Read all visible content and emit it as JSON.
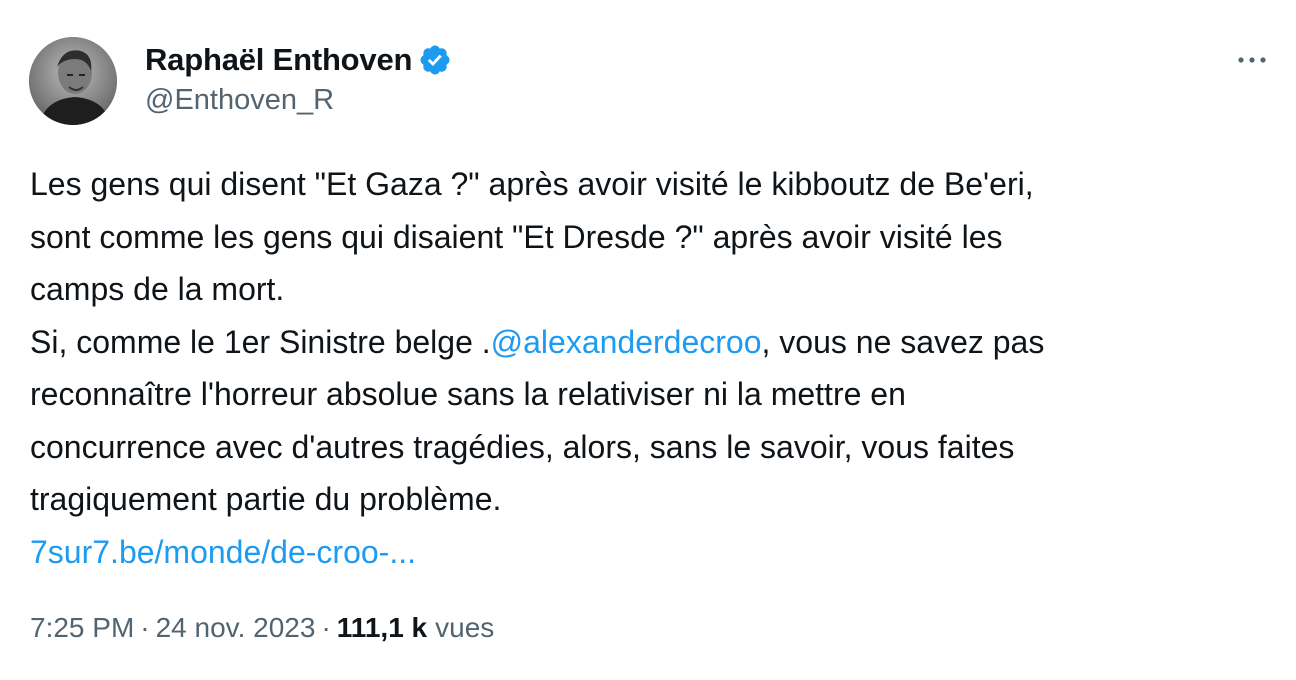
{
  "author": {
    "name": "Raphaël Enthoven",
    "handle": "@Enthoven_R",
    "verified_icon": "verified-badge-icon",
    "verified_color": "#1d9bf0",
    "avatar_icon": "profile-photo"
  },
  "menu": {
    "icon": "more-options-icon"
  },
  "tweet": {
    "line1": "Les gens qui disent \"Et Gaza ?\" après avoir visité le kibboutz de Be'eri,",
    "line2": "sont comme les gens qui disaient \"Et Dresde ?\" après avoir visité les",
    "line3": "camps de la mort.",
    "line4_before": "Si, comme le 1er Sinistre belge .",
    "mention": "@alexanderdecroo",
    "line4_after": ", vous ne savez pas",
    "line5": "reconnaître l'horreur absolue sans la relativiser ni la mettre en",
    "line6": "concurrence avec d'autres tragédies, alors, sans le savoir, vous faites",
    "line7": "tragiquement partie du problème.",
    "url": "7sur7.be/monde/de-croo-..."
  },
  "meta": {
    "time": "7:25 PM",
    "separator": "·",
    "date": "24 nov. 2023",
    "views_count": "111,1 k",
    "views_label": "vues"
  },
  "colors": {
    "text": "#0f1419",
    "secondary": "#536471",
    "link": "#1d9bf0",
    "background": "#ffffff"
  }
}
